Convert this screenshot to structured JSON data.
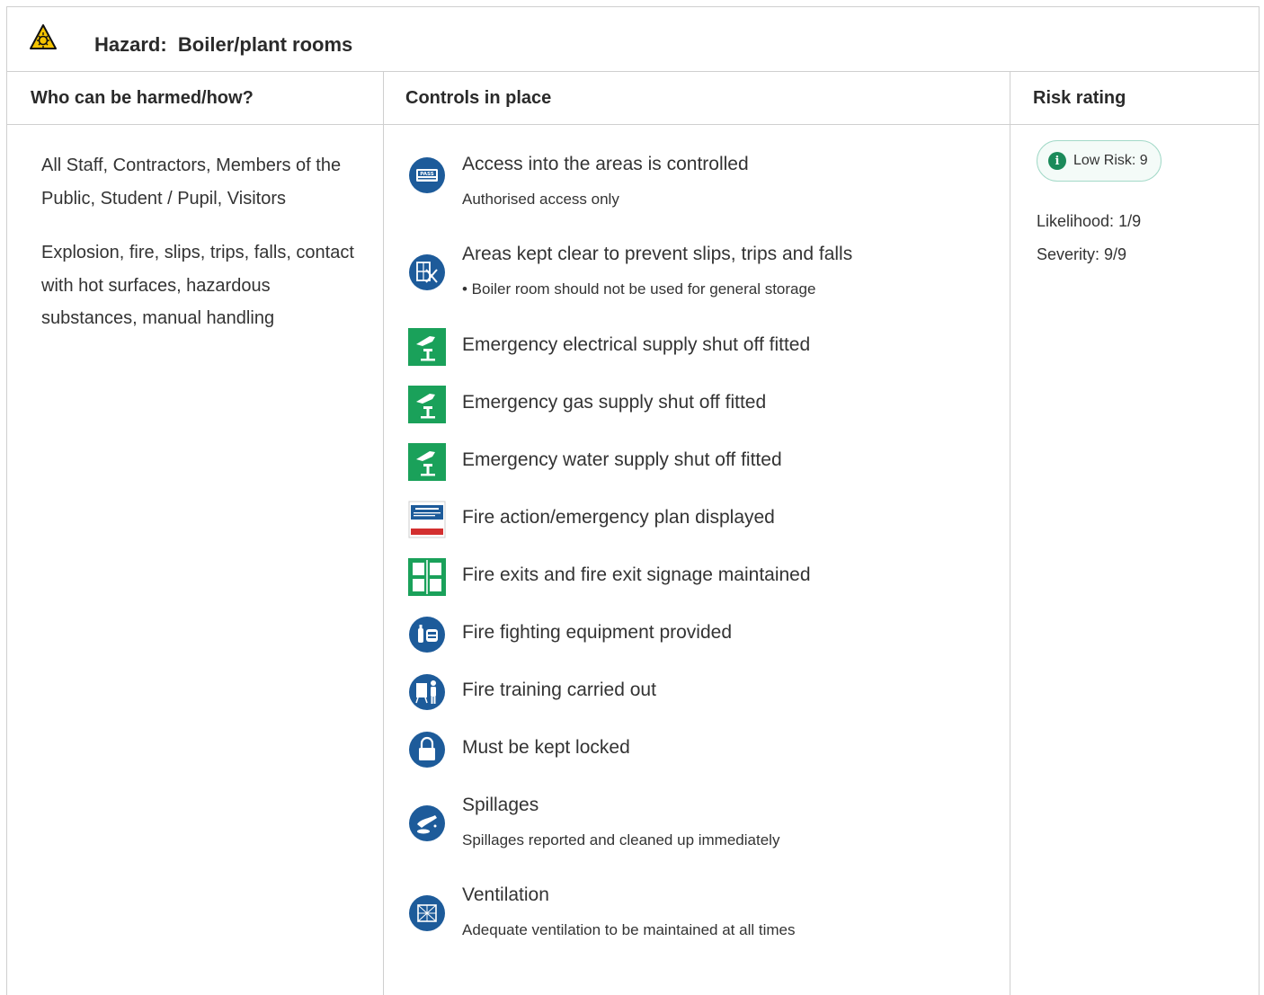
{
  "hazard": {
    "label": "Hazard:",
    "name": "Boiler/plant rooms",
    "icon": "hazard-warning-icon"
  },
  "columns": {
    "who": "Who can be harmed/how?",
    "controls": "Controls in place",
    "risk": "Risk rating"
  },
  "who": {
    "people": "All Staff, Contractors, Members of the Public, Student / Pupil, Visitors",
    "harms": "Explosion, fire, slips, trips, falls, contact with hot surfaces, hazardous substances, manual handling"
  },
  "controls": [
    {
      "title": "Access into the areas is controlled",
      "detail": "Authorised access only",
      "icon": "pass-icon"
    },
    {
      "title": "Areas kept clear to prevent slips, trips and falls",
      "detail": "• Boiler room should not be used for general storage",
      "icon": "no-storage-icon"
    },
    {
      "title": "Emergency electrical supply shut off fitted",
      "detail": "",
      "icon": "emergency-shutoff-icon"
    },
    {
      "title": "Emergency gas supply shut off fitted",
      "detail": "",
      "icon": "emergency-shutoff-icon"
    },
    {
      "title": "Emergency water supply shut off fitted",
      "detail": "",
      "icon": "emergency-shutoff-icon"
    },
    {
      "title": "Fire action/emergency plan displayed",
      "detail": "",
      "icon": "fire-action-notice-icon"
    },
    {
      "title": "Fire exits and fire exit signage maintained",
      "detail": "",
      "icon": "fire-exit-icon"
    },
    {
      "title": "Fire fighting equipment provided",
      "detail": "",
      "icon": "fire-extinguisher-icon"
    },
    {
      "title": "Fire training carried out",
      "detail": "",
      "icon": "training-icon"
    },
    {
      "title": "Must be kept locked",
      "detail": "",
      "icon": "padlock-icon"
    },
    {
      "title": "Spillages",
      "detail": "Spillages reported and cleaned up immediately",
      "icon": "spillage-icon"
    },
    {
      "title": "Ventilation",
      "detail": "Adequate ventilation to be maintained at all times",
      "icon": "ventilation-icon"
    }
  ],
  "risk": {
    "badge": "Low Risk: 9",
    "badge_icon": "info-icon",
    "badge_color": "#1b8a5a",
    "likelihood": "Likelihood: 1/9",
    "severity": "Severity: 9/9"
  },
  "colors": {
    "mandatory_blue": "#1d5b9a",
    "safe_green": "#1aa15a",
    "warning_yellow": "#f5c400"
  }
}
